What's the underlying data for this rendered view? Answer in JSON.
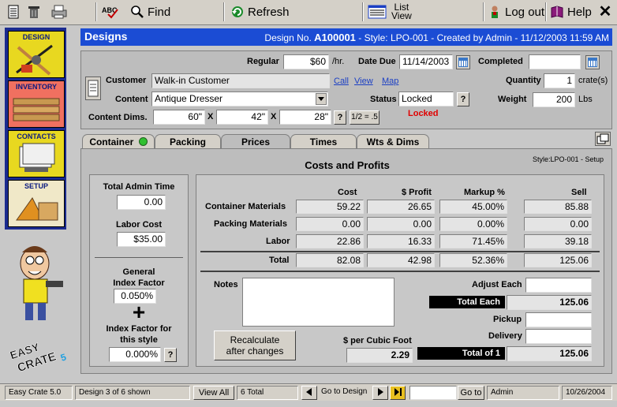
{
  "toolbar": {
    "find_label": "Find",
    "refresh_label": "Refresh",
    "list_view_line1": "List",
    "list_view_line2": "View",
    "logout_label": "Log out",
    "help_label": "Help",
    "close_label": "✕"
  },
  "sidebar": {
    "items": [
      {
        "label": "DESIGN"
      },
      {
        "label": "INVENTORY"
      },
      {
        "label": "CONTACTS"
      },
      {
        "label": "SETUP"
      }
    ],
    "logo_text": "EASY CRATE 5"
  },
  "header": {
    "title": "Designs",
    "design_no_label": "Design No.",
    "design_no": "A100001",
    "meta": "- Style: LPO-001 - Created by Admin  -  11/12/2003  11:59 AM"
  },
  "form": {
    "regular_label": "Regular",
    "regular_value": "$60",
    "regular_unit": "/hr.",
    "date_due_label": "Date Due",
    "date_due_value": "11/14/2003",
    "completed_label": "Completed",
    "completed_value": "",
    "customer_label": "Customer",
    "customer_value": "Walk-in Customer",
    "call_link": "Call",
    "view_link": "View",
    "map_link": "Map",
    "quantity_label": "Quantity",
    "quantity_value": "1",
    "quantity_unit": "crate(s)",
    "content_label": "Content",
    "content_value": "Antique Dresser",
    "status_label": "Status",
    "status_value": "Locked",
    "status_help": "?",
    "status_text": "Locked",
    "weight_label": "Weight",
    "weight_value": "200",
    "weight_unit": "Lbs",
    "dims_label": "Content Dims.",
    "dim1": "60\"",
    "dim2": "42\"",
    "dim3": "28\"",
    "x_sep": "X",
    "dims_help": "?",
    "half_btn": "1/2 = .5"
  },
  "tabs": [
    {
      "label": "Container"
    },
    {
      "label": "Packing"
    },
    {
      "label": "Prices"
    },
    {
      "label": "Times"
    },
    {
      "label": "Wts & Dims"
    }
  ],
  "prices": {
    "section_title": "Costs and Profits",
    "style_setup": "Style:LPO-001  -  Setup",
    "total_admin_time_label": "Total Admin Time",
    "total_admin_time_value": "0.00",
    "labor_cost_label": "Labor Cost",
    "labor_cost_value": "$35.00",
    "general_index_label_1": "General",
    "general_index_label_2": "Index Factor",
    "general_index_value": "0.050%",
    "plus_sign": "+",
    "style_index_label_1": "Index Factor for",
    "style_index_label_2": "this style",
    "style_index_value": "0.000%",
    "style_index_help": "?",
    "columns": [
      "Cost",
      "$ Profit",
      "Markup %",
      "Sell"
    ],
    "rows": [
      {
        "label": "Container Materials",
        "cost": "59.22",
        "profit": "26.65",
        "markup": "45.00%",
        "sell": "85.88"
      },
      {
        "label": "Packing Materials",
        "cost": "0.00",
        "profit": "0.00",
        "markup": "0.00%",
        "sell": "0.00"
      },
      {
        "label": "Labor",
        "cost": "22.86",
        "profit": "16.33",
        "markup": "71.45%",
        "sell": "39.18"
      }
    ],
    "total": {
      "label": "Total",
      "cost": "82.08",
      "profit": "42.98",
      "markup": "52.36%",
      "sell": "125.06"
    },
    "notes_label": "Notes",
    "notes_value": "",
    "recalc_line1": "Recalculate",
    "recalc_line2": "after changes",
    "per_cubic_label": "$ per Cubic Foot",
    "per_cubic_value": "2.29",
    "adjust_each_label": "Adjust Each",
    "adjust_each_value": "",
    "total_each_label": "Total Each",
    "total_each_value": "125.06",
    "pickup_label": "Pickup",
    "pickup_value": "",
    "delivery_label": "Delivery",
    "delivery_value": "",
    "total_of_label": "Total of 1",
    "total_of_value": "125.06"
  },
  "statusbar": {
    "app": "Easy Crate 5.0",
    "record": "Design 3 of 6 shown",
    "view_all": "View All",
    "total": "6 Total",
    "go_to_design": "Go to Design",
    "go_to_value": "",
    "go_to_btn": "Go to",
    "user": "Admin",
    "date": "10/26/2004"
  }
}
